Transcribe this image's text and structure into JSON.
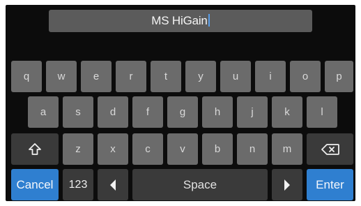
{
  "name_field": {
    "value": "MS HiGain"
  },
  "keyboard": {
    "row1": [
      "q",
      "w",
      "e",
      "r",
      "t",
      "y",
      "u",
      "i",
      "o",
      "p"
    ],
    "row2": [
      "a",
      "s",
      "d",
      "f",
      "g",
      "h",
      "j",
      "k",
      "l"
    ],
    "row3": [
      "z",
      "x",
      "c",
      "v",
      "b",
      "n",
      "m"
    ],
    "cancel_label": "Cancel",
    "numbers_label": "123",
    "space_label": "Space",
    "enter_label": "Enter",
    "shift_icon": "shift-arrow-icon",
    "backspace_icon": "backspace-icon",
    "left_icon": "cursor-left-icon",
    "right_icon": "cursor-right-icon"
  },
  "colors": {
    "background": "#0c0c0c",
    "letter_key": "#6b6b6b",
    "function_key": "#3a3a3a",
    "accent_key": "#2f7fd0",
    "cursor": "#5a9ee8"
  }
}
